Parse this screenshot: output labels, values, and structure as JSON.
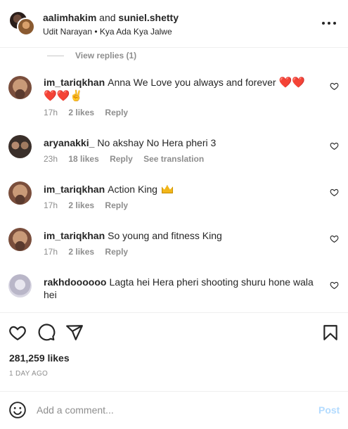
{
  "header": {
    "user1": "aalimhakim",
    "joiner": "and",
    "user2": "suniel.shetty",
    "audio": "Udit Narayan • Kya Ada Kya Jalwe"
  },
  "view_replies": "View replies (1)",
  "comments": [
    {
      "user": "im_tariqkhan",
      "text": "Anna We Love you always and forever",
      "emojis": "❤️❤️❤️❤️✌",
      "time": "17h",
      "likes": "2 likes",
      "reply": "Reply"
    },
    {
      "user": "aryanakki_",
      "text": "No akshay No Hera pheri 3",
      "time": "23h",
      "likes": "18 likes",
      "reply": "Reply",
      "translate": "See translation"
    },
    {
      "user": "im_tariqkhan",
      "text": "Action King",
      "emoji_icon": "crown-emoji",
      "time": "17h",
      "likes": "2 likes",
      "reply": "Reply"
    },
    {
      "user": "im_tariqkhan",
      "text": "So young and fitness King",
      "time": "17h",
      "likes": "2 likes",
      "reply": "Reply"
    },
    {
      "user": "rakhdoooooo",
      "text": "Lagta hei Hera pheri shooting shuru hone wala hei"
    }
  ],
  "actions": {
    "icons": [
      "heart-icon",
      "comment-icon",
      "share-icon",
      "bookmark-icon"
    ],
    "likes": "281,259 likes",
    "time": "1 DAY AGO"
  },
  "add_comment": {
    "placeholder": "Add a comment...",
    "post": "Post"
  },
  "colors": {
    "heart": "#ed1c24",
    "post": "#b3dbff",
    "muted": "#8e8e8e"
  }
}
